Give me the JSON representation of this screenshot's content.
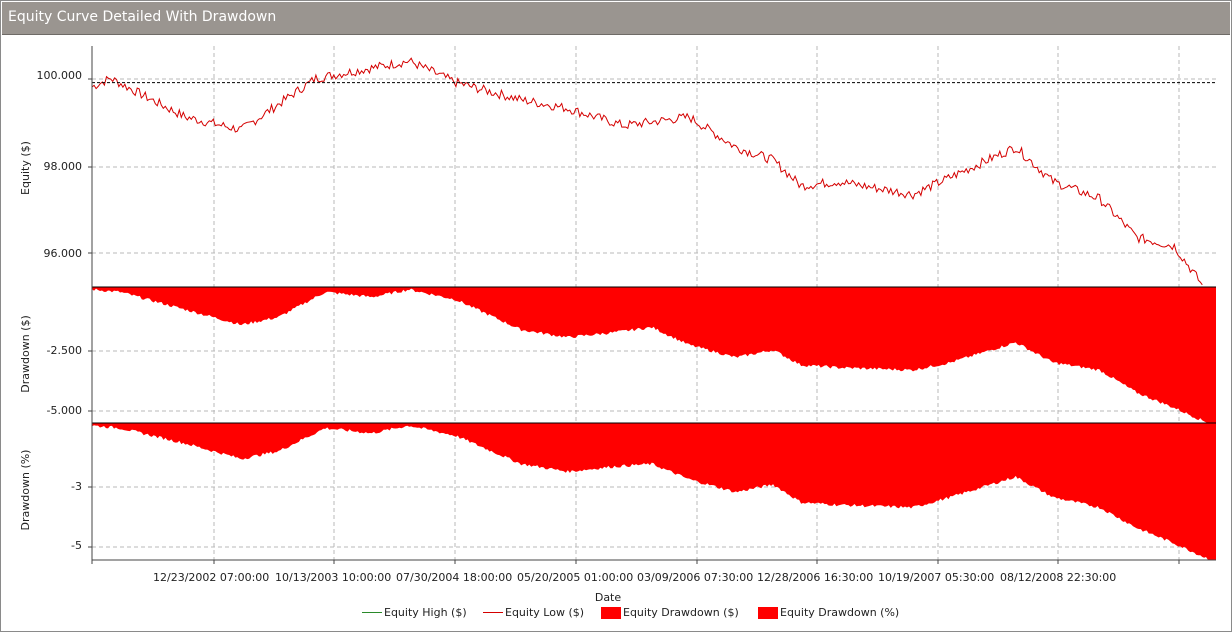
{
  "window": {
    "title": "Equity Curve Detailed With Drawdown"
  },
  "colors": {
    "equity_high": "#2a8a2a",
    "equity_low": "#d40000",
    "drawdown_fill": "#ff0000",
    "grid": "#b8b8b8",
    "reference_line": "#000000"
  },
  "chart_data": [
    {
      "type": "line",
      "ylabel": "Equity ($)",
      "ytick_labels": [
        "100.000",
        "98.000",
        "96.000"
      ],
      "ylim": [
        95.25,
        100.85
      ],
      "reference_y": 100,
      "series": [
        {
          "name": "Equity High ($)",
          "color": "#2a8a2a"
        },
        {
          "name": "Equity Low ($)",
          "color": "#d40000",
          "x_index": [
            0,
            0.2,
            0.55,
            1.0,
            1.6,
            2.4,
            3.4,
            3.9,
            4.6,
            5.1,
            5.7,
            6.4,
            6.9,
            7.3,
            7.6,
            8.0,
            8.8,
            9.2,
            9.9,
            10.3,
            10.8,
            11.2,
            11.6,
            11.9
          ],
          "values": [
            99.9,
            100.1,
            99.7,
            99.2,
            98.9,
            100.1,
            100.5,
            100.0,
            99.6,
            99.4,
            99.0,
            99.2,
            98.5,
            98.2,
            97.6,
            97.7,
            97.4,
            97.8,
            98.5,
            97.7,
            97.3,
            96.4,
            96.2,
            95.3
          ]
        }
      ]
    },
    {
      "type": "area",
      "ylabel": "Drawdown ($)",
      "ytick_labels": [
        "-2.500",
        "-5.000"
      ],
      "ylim": [
        -5.4,
        0
      ],
      "series": [
        {
          "name": "Equity Drawdown ($)",
          "color": "#ff0000",
          "x_index": [
            0,
            0.3,
            1.0,
            1.6,
            2.0,
            2.5,
            3.0,
            3.4,
            3.9,
            4.6,
            5.1,
            5.6,
            6.0,
            6.4,
            6.9,
            7.3,
            7.6,
            8.0,
            8.8,
            9.2,
            9.9,
            10.3,
            10.8,
            11.2,
            11.6,
            11.9,
            12.0
          ],
          "values": [
            -0.1,
            -0.2,
            -0.9,
            -1.5,
            -1.2,
            -0.2,
            -0.4,
            -0.1,
            -0.5,
            -1.7,
            -2.0,
            -1.8,
            -1.6,
            -2.3,
            -2.8,
            -2.5,
            -3.1,
            -3.2,
            -3.3,
            -3.0,
            -2.2,
            -3.0,
            -3.3,
            -4.2,
            -4.8,
            -5.3,
            -5.4
          ]
        }
      ]
    },
    {
      "type": "area",
      "ylabel": "Drawdown (%)",
      "ytick_labels": [
        "-3",
        "-5"
      ],
      "ylim": [
        -5.35,
        0
      ],
      "series": [
        {
          "name": "Equity Drawdown (%)",
          "color": "#ff0000",
          "x_index": [
            0,
            0.3,
            1.0,
            1.6,
            2.0,
            2.5,
            3.0,
            3.4,
            3.9,
            4.6,
            5.1,
            5.6,
            6.0,
            6.4,
            6.9,
            7.3,
            7.6,
            8.0,
            8.8,
            9.2,
            9.9,
            10.3,
            10.8,
            11.2,
            11.6,
            11.9,
            12.0
          ],
          "values": [
            -0.1,
            -0.2,
            -0.8,
            -1.4,
            -1.1,
            -0.2,
            -0.4,
            -0.1,
            -0.5,
            -1.6,
            -1.9,
            -1.7,
            -1.6,
            -2.2,
            -2.7,
            -2.4,
            -3.1,
            -3.2,
            -3.3,
            -2.9,
            -2.1,
            -2.9,
            -3.3,
            -4.1,
            -4.7,
            -5.2,
            -5.35
          ]
        }
      ]
    }
  ],
  "x_axis": {
    "label": "Date",
    "tick_labels": [
      "12/23/2002 07:00:00",
      "10/13/2003 10:00:00",
      "07/30/2004 18:00:00",
      "05/20/2005 01:00:00",
      "03/09/2006 07:30:00",
      "12/28/2006 16:30:00",
      "10/19/2007 05:30:00",
      "08/12/2008 22:30:00"
    ]
  },
  "legend": [
    {
      "label": "Equity High ($)",
      "kind": "line",
      "color": "#2a8a2a"
    },
    {
      "label": "Equity Low ($)",
      "kind": "line",
      "color": "#d40000"
    },
    {
      "label": "Equity Drawdown ($)",
      "kind": "box",
      "color": "#ff0000"
    },
    {
      "label": "Equity Drawdown (%)",
      "kind": "box",
      "color": "#ff0000"
    }
  ]
}
